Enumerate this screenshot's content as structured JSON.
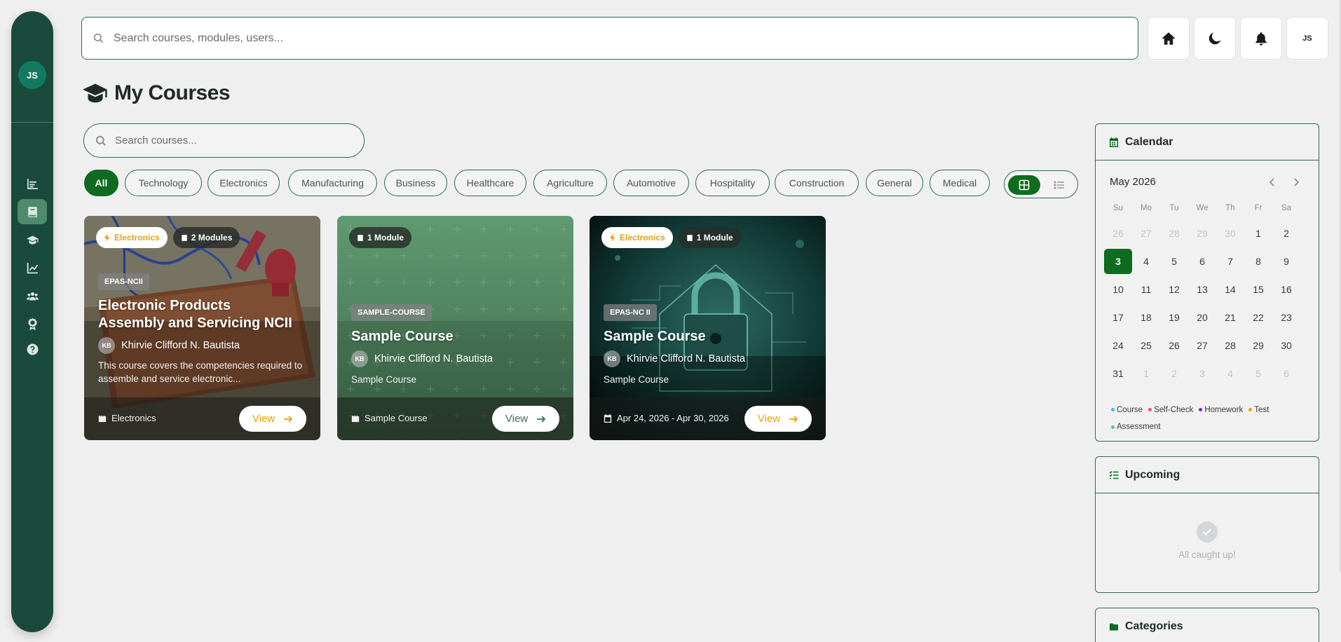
{
  "sidebar": {
    "avatar_initials": "JS",
    "items": [
      {
        "icon": "bar-chart-icon"
      },
      {
        "icon": "book-icon",
        "active": true
      },
      {
        "icon": "graduation-cap-icon"
      },
      {
        "icon": "line-chart-icon"
      },
      {
        "icon": "users-icon"
      },
      {
        "icon": "award-icon"
      },
      {
        "icon": "help-icon"
      }
    ]
  },
  "topbar": {
    "search_placeholder": "Search courses, modules, users...",
    "user_initials": "JS"
  },
  "page": {
    "title": "My Courses",
    "course_search_placeholder": "Search courses..."
  },
  "filters": [
    "All",
    "Technology",
    "Electronics",
    "Manufacturing",
    "Business",
    "Healthcare",
    "Agriculture",
    "Automotive",
    "Hospitality",
    "Construction",
    "General",
    "Medical"
  ],
  "active_filter": "All",
  "courses": [
    {
      "category_badge": "Electronics",
      "modules_badge": "2 Modules",
      "code": "EPAS-NCII",
      "title": "Electronic Products Assembly and Servicing NCII",
      "instructor_initials": "KB",
      "instructor": "Khirvie Clifford N. Bautista",
      "description": "This course covers the competencies required to assemble and service electronic...",
      "footer": "Electronics",
      "view_label": "View"
    },
    {
      "modules_badge": "1 Module",
      "code": "SAMPLE-COURSE",
      "title": "Sample Course",
      "instructor_initials": "KB",
      "instructor": "Khirvie Clifford N. Bautista",
      "description": "Sample Course",
      "footer": "Sample Course",
      "view_label": "View"
    },
    {
      "category_badge": "Electronics",
      "modules_badge": "1 Module",
      "code": "EPAS-NC II",
      "title": "Sample Course",
      "instructor_initials": "KB",
      "instructor": "Khirvie Clifford N. Bautista",
      "description": "Sample Course",
      "footer": "Apr 24, 2026 - Apr 30, 2026",
      "view_label": "View"
    }
  ],
  "calendar": {
    "title": "Calendar",
    "month": "May 2026",
    "weekdays": [
      "Su",
      "Mo",
      "Tu",
      "We",
      "Th",
      "Fr",
      "Sa"
    ],
    "days": [
      {
        "d": "26",
        "m": true
      },
      {
        "d": "27",
        "m": true
      },
      {
        "d": "28",
        "m": true
      },
      {
        "d": "29",
        "m": true
      },
      {
        "d": "30",
        "m": true
      },
      {
        "d": "1"
      },
      {
        "d": "2"
      },
      {
        "d": "3",
        "today": true
      },
      {
        "d": "4"
      },
      {
        "d": "5"
      },
      {
        "d": "6"
      },
      {
        "d": "7"
      },
      {
        "d": "8"
      },
      {
        "d": "9"
      },
      {
        "d": "10"
      },
      {
        "d": "11"
      },
      {
        "d": "12"
      },
      {
        "d": "13"
      },
      {
        "d": "14"
      },
      {
        "d": "15"
      },
      {
        "d": "16"
      },
      {
        "d": "17"
      },
      {
        "d": "18"
      },
      {
        "d": "19"
      },
      {
        "d": "20"
      },
      {
        "d": "21"
      },
      {
        "d": "22"
      },
      {
        "d": "23"
      },
      {
        "d": "24"
      },
      {
        "d": "25"
      },
      {
        "d": "26"
      },
      {
        "d": "27"
      },
      {
        "d": "28"
      },
      {
        "d": "29"
      },
      {
        "d": "30"
      },
      {
        "d": "31"
      },
      {
        "d": "1",
        "m": true
      },
      {
        "d": "2",
        "m": true
      },
      {
        "d": "3",
        "m": true
      },
      {
        "d": "4",
        "m": true
      },
      {
        "d": "5",
        "m": true
      },
      {
        "d": "6",
        "m": true
      }
    ],
    "legend": [
      {
        "label": "Course",
        "color": "#38bdf8"
      },
      {
        "label": "Self-Check",
        "color": "#ec4899"
      },
      {
        "label": "Homework",
        "color": "#7e22ce"
      },
      {
        "label": "Test",
        "color": "#f59e0b"
      },
      {
        "label": "Assessment",
        "color": "#34d399"
      }
    ]
  },
  "upcoming": {
    "title": "Upcoming",
    "empty_text": "All caught up!"
  },
  "categories": {
    "title": "Categories"
  },
  "colors": {
    "brand_green": "#0e6b1f",
    "sidebar": "#1a4a3c",
    "accent_gold": "#e7a10c"
  }
}
